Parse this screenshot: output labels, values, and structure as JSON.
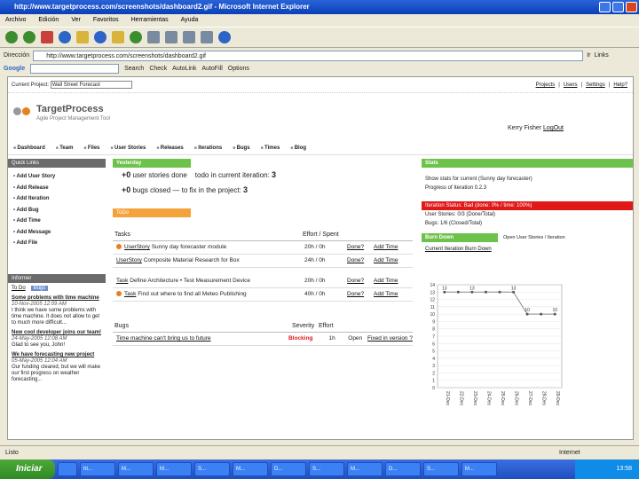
{
  "window": {
    "title": "http://www.targetprocess.com/screenshots/dashboard2.gif - Microsoft Internet Explorer"
  },
  "menu": [
    "Archivo",
    "Edición",
    "Ver",
    "Favoritos",
    "Herramientas",
    "Ayuda"
  ],
  "address": {
    "label": "Dirección",
    "url": "http://www.targetprocess.com/screenshots/dashboard2.gif",
    "go": "Ir",
    "links": "Links"
  },
  "google": {
    "label": "Google",
    "search": "Search",
    "check": "Check",
    "autolink": "AutoLink",
    "autofill": "AutoFill",
    "options": "Options"
  },
  "page": {
    "current_project_label": "Current Project:",
    "current_project_value": "Wall Street Forecast",
    "top_links": [
      "Projects",
      "Users",
      "Settings",
      "Help?"
    ],
    "logo_title": "TargetProcess",
    "logo_subtitle": "Agile Project Management Tool",
    "user_name": "Kerry Fisher",
    "logout": "LogOut",
    "nav": [
      "Dashboard",
      "Team",
      "Files",
      "User Stories",
      "Releases",
      "Iterations",
      "Bugs",
      "Times",
      "Blog"
    ],
    "quick_links_title": "Quick Links",
    "quick_links": [
      "Add User Story",
      "Add Release",
      "Add Iteration",
      "Add Bug",
      "Add Time",
      "Add Message",
      "Add File"
    ],
    "informer_title": "Informer",
    "informer_tabs": [
      "To Do",
      "Bugs"
    ],
    "news": [
      {
        "title": "Some problems with time machine",
        "date": "10-Nov-2005 12:09 AM",
        "text": "I think we have some problems with time machine. It does not allow to get to much more difficult..."
      },
      {
        "title": "New cool developer joins our team!",
        "date": "24-May-2005 12:08 AM",
        "text": "Glad to see you, John!"
      },
      {
        "title": "We have forecasting new project",
        "date": "05-May-2005 12:04 AM",
        "text": "Our funding cleared, but we will make our first progress on weather forecasting..."
      }
    ],
    "yesterday_title": "Yesterday",
    "yesterday": [
      {
        "count": "+0",
        "text1": "user stories done",
        "text2": "todo in current iteration:",
        "num": "3"
      },
      {
        "count": "+0",
        "text1": "bugs closed",
        "text2": "to fix in the project:",
        "num": "3"
      }
    ],
    "todo_title": "ToDo",
    "tasks_header": {
      "title": "Tasks",
      "effort": "Effort / Spent"
    },
    "tasks": [
      {
        "type": "UserStory",
        "name": "Sunny day forecaster module",
        "effort": "20h / 0h",
        "status": "Done?",
        "action": "Add Time"
      },
      {
        "type": "UserStory",
        "name": "Composite Material Research for Box",
        "effort": "24h / 0h",
        "status": "Done?",
        "action": "Add Time"
      },
      {
        "type": "Task",
        "name": "Define Architecture",
        "extra": "Test Measurement Device",
        "effort": "20h / 0h",
        "status": "Done?",
        "action": "Add Time"
      },
      {
        "type": "Task",
        "name": "Find out where to find all Meteo Publishing",
        "effort": "40h / 0h",
        "status": "Done?",
        "action": "Add Time"
      }
    ],
    "bugs_header": {
      "title": "Bugs",
      "severity": "Severity",
      "effort": "Effort"
    },
    "bugs": [
      {
        "name": "Time machine can't bring us to future",
        "severity": "Blocking",
        "effort": "1h",
        "status": "Open",
        "action": "Fixed in version ?"
      }
    ],
    "stats_title": "Stats",
    "stats_lines": [
      "Show stats for current (Sunny day forecaster)",
      "Progress of Iteration 0.2.3"
    ],
    "iteration_status": "Iteration Status: Bad (done: 0% / time: 100%)",
    "user_stories_stat": "User Stories: 0/3 (Done/Total)",
    "bugs_stat": "Bugs: 1/6 (Closed/Total)",
    "burn_down_title": "Burn Down",
    "burn_down_options": "Open User Stories / Iteration",
    "burn_down_link": "Current Iteration Burn Down"
  },
  "chart_data": {
    "type": "line",
    "title": "",
    "x": [
      "21-Dec",
      "22-Dec",
      "23-Dec",
      "24-Dec",
      "25-Dec",
      "26-Dec",
      "27-Dec",
      "28-Dec",
      "29-Dec"
    ],
    "values": [
      13,
      13,
      13,
      13,
      13,
      13,
      10,
      10,
      10
    ],
    "ylim": [
      0,
      14
    ],
    "yticks": [
      0,
      1,
      2,
      3,
      4,
      5,
      6,
      7,
      8,
      9,
      10,
      11,
      12,
      13,
      14
    ],
    "point_labels": [
      "13",
      "",
      "13",
      "",
      "",
      "13",
      "10",
      "",
      "10"
    ]
  },
  "status": {
    "left": "Listo",
    "zone": "Internet"
  },
  "taskbar": {
    "start": "Iniciar",
    "tasks": [
      "",
      "ht...",
      "M...",
      "M...",
      "S...",
      "M...",
      "D...",
      "S...",
      "M...",
      "D...",
      "S...",
      "M...",
      "S...",
      "M..."
    ],
    "clock": "13:58"
  },
  "colors": {
    "green": "#6cc24a",
    "orange": "#f4a23b",
    "red": "#e01818"
  }
}
